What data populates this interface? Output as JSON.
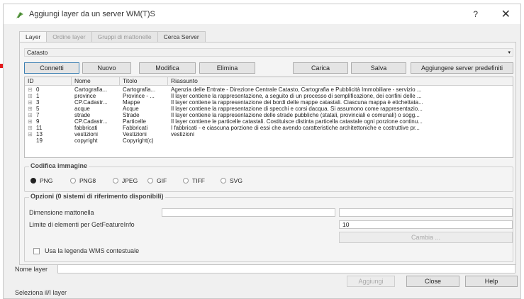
{
  "window": {
    "title": "Aggiungi layer da un server WM(T)S",
    "help": "?",
    "close": "✕"
  },
  "tabs": [
    {
      "label": "Layer",
      "state": "active"
    },
    {
      "label": "Ordine layer",
      "state": "disabled"
    },
    {
      "label": "Gruppi di mattonelle",
      "state": "disabled"
    },
    {
      "label": "Cerca Server",
      "state": "enabled"
    }
  ],
  "connection": {
    "selected": "Catasto"
  },
  "buttons": {
    "connect": "Connetti",
    "new": "Nuovo",
    "edit": "Modifica",
    "delete": "Elimina",
    "load": "Carica",
    "save": "Salva",
    "add_default": "Aggiungere server predefiniti"
  },
  "layers_table": {
    "headers": [
      "ID",
      "Nome",
      "Titolo",
      "Riassunto"
    ],
    "rows": [
      {
        "tree": "⊟",
        "id": "0",
        "name": "Cartografia...",
        "title": "Cartografia...",
        "summary": "Agenzia delle Entrate - Direzione Centrale Catasto, Cartografia e Pubblicità Immobiliare - servizio ..."
      },
      {
        "tree": "⊞",
        "id": "1",
        "name": "province",
        "title": "Province - ...",
        "summary": "Il layer contiene la rappresentazione, a seguito di un processo di semplificazione, dei confini delle ..."
      },
      {
        "tree": "⊞",
        "id": "3",
        "name": "CP.Cadastr...",
        "title": "Mappe",
        "summary": "Il layer contiene la rappresentazione dei bordi delle mappe catastali. Ciascuna mappa è etichettata..."
      },
      {
        "tree": "⊞",
        "id": "5",
        "name": "acque",
        "title": "Acque",
        "summary": "Il layer contiene la rappresentazione di specchi e corsi dacqua. Si assumono come rappresentazio..."
      },
      {
        "tree": "⊞",
        "id": "7",
        "name": "strade",
        "title": "Strade",
        "summary": "Il layer contiene la rappresentazione delle strade pubbliche (statali, provinciali e comunali) o sogg..."
      },
      {
        "tree": "⊞",
        "id": "9",
        "name": "CP.Cadastr...",
        "title": "Particelle",
        "summary": "Il layer contiene le particelle catastali. Costituisce distinta particella catastale ogni porzione continu..."
      },
      {
        "tree": "⊞",
        "id": "11",
        "name": "fabbricati",
        "title": "Fabbricati",
        "summary": "I fabbricati - e ciascuna porzione di essi che avendo caratteristiche architettoniche e costruttive pr..."
      },
      {
        "tree": "⊞",
        "id": "13",
        "name": "vestizioni",
        "title": "Vestizioni",
        "summary": "vestizioni"
      },
      {
        "tree": "",
        "id": "19",
        "name": "copyright",
        "title": "Copyright(c)",
        "summary": ""
      }
    ]
  },
  "image_encoding": {
    "title": "Codifica immagine",
    "options": [
      "PNG",
      "PNG8",
      "JPEG",
      "GIF",
      "TIFF",
      "SVG"
    ],
    "selected": "PNG"
  },
  "options": {
    "title": "Opzioni (0 sistemi di riferimento disponibili)",
    "tile_size_label": "Dimensione mattonella",
    "tile_size_value": "",
    "feature_limit_label": "Limite di elementi per GetFeatureInfo",
    "feature_limit_value": "10",
    "change_button": "Cambia ...",
    "wms_legend_label": "Usa la legenda WMS contestuale"
  },
  "layer_name": {
    "label": "Nome layer",
    "value": ""
  },
  "footer": {
    "add": "Aggiungi",
    "close": "Close",
    "help": "Help",
    "status": "Seleziona il/I layer"
  },
  "colors": {
    "annotation_arrow": "#e3191b"
  }
}
